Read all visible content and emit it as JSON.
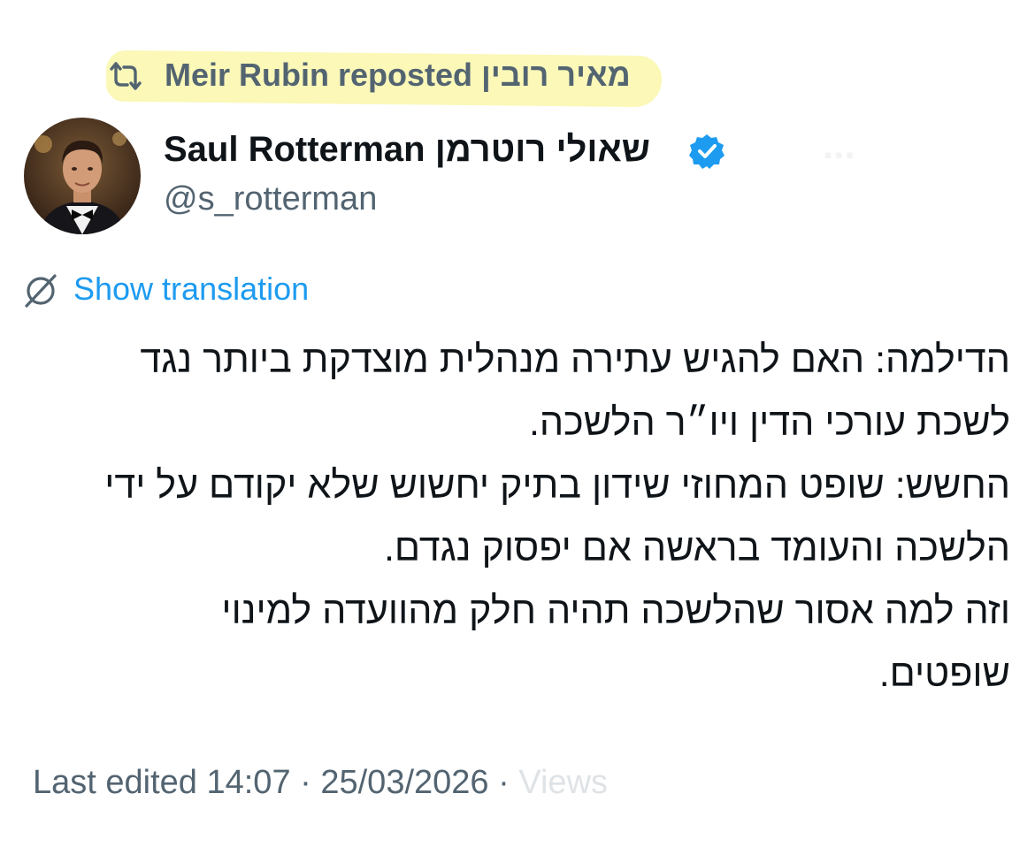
{
  "repost": {
    "text": "Meir Rubin reposted מאיר רובין",
    "icon": "repost-icon",
    "highlight_color": "#fbf7b0"
  },
  "author": {
    "display_name": "Saul Rotterman שאולי רוטרמן",
    "handle": "@s_rotterman",
    "verified_icon": "verified-badge-icon",
    "verified_color": "#1d9bf0"
  },
  "follow_button": {
    "label": "..."
  },
  "translation": {
    "label": "Show translation",
    "icon": "globe-icon",
    "color": "#1d9bf0"
  },
  "tweet": {
    "lines": [
      "הדילמה: האם להגיש עתירה מנהלית מוצדקת ביותר נגד",
      "לשכת עורכי הדין ויו״ר הלשכה.",
      "החשש: שופט המחוזי שידון בתיק יחשוש שלא יקודם על ידי",
      "הלשכה והעומד בראשה אם יפסוק נגדם.",
      "וזה למה אסור שהלשכה תהיה חלק מהוועדה למינוי",
      "שופטים."
    ]
  },
  "meta": {
    "edited_label": "Last edited",
    "time": "14:07",
    "separator": "·",
    "date": "25/03/2026",
    "views": "Views"
  },
  "colors": {
    "text": "#0f1419",
    "secondary": "#536471",
    "link": "#1d9bf0"
  }
}
